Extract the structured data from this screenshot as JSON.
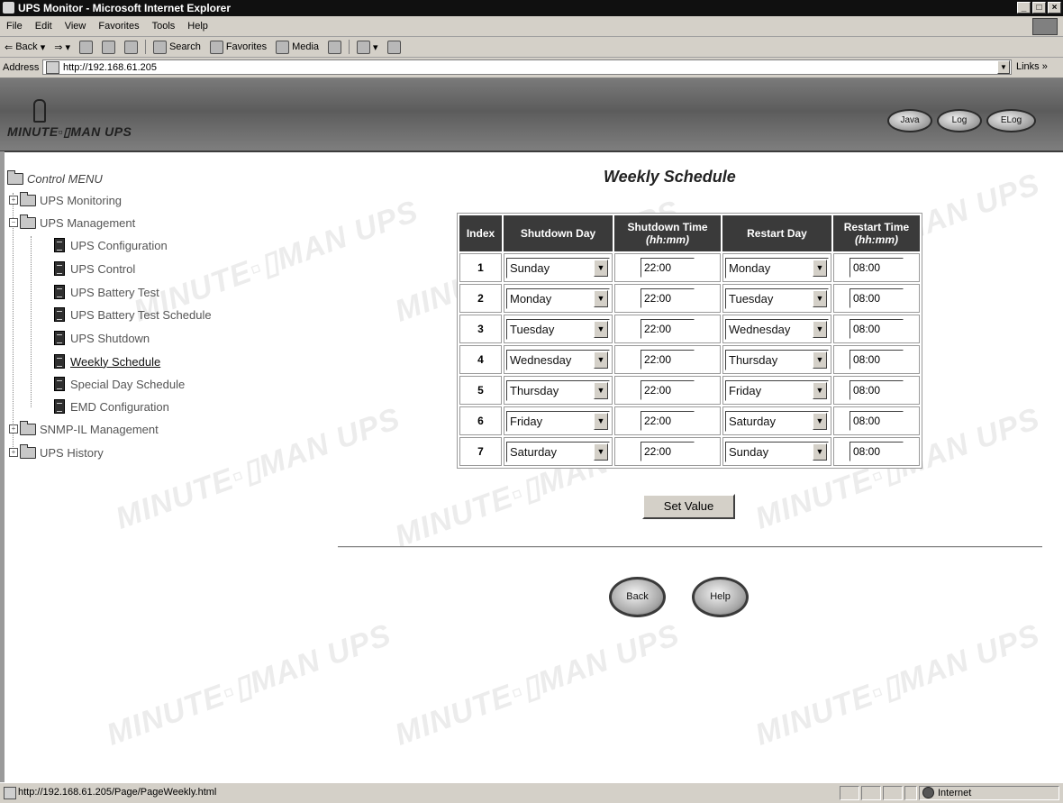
{
  "window": {
    "title": "UPS Monitor - Microsoft Internet Explorer",
    "buttons": [
      "_",
      "□",
      "×"
    ]
  },
  "menubar": [
    "File",
    "Edit",
    "View",
    "Favorites",
    "Tools",
    "Help"
  ],
  "toolbar": {
    "back": "Back",
    "search": "Search",
    "favorites": "Favorites",
    "media": "Media"
  },
  "address": {
    "label": "Address",
    "url": "http://192.168.61.205",
    "links": "Links"
  },
  "header": {
    "logo": "MINUTE▫▯MAN UPS",
    "buttons": [
      "Java",
      "Log",
      "ELog"
    ]
  },
  "leftmenu": {
    "title": "Control MENU",
    "items": [
      {
        "label": "UPS Monitoring"
      },
      {
        "label": "UPS Management"
      },
      {
        "label": "UPS Configuration"
      },
      {
        "label": "UPS Control"
      },
      {
        "label": "UPS Battery Test"
      },
      {
        "label": "UPS Battery Test Schedule"
      },
      {
        "label": "UPS Shutdown"
      },
      {
        "label": "Weekly Schedule"
      },
      {
        "label": "Special Day Schedule"
      },
      {
        "label": "EMD Configuration"
      },
      {
        "label": "SNMP-IL Management"
      },
      {
        "label": "UPS History"
      }
    ]
  },
  "main": {
    "title": "Weekly Schedule",
    "columns": [
      "Index",
      "Shutdown Day",
      "Shutdown Time",
      "(hh:mm)",
      "Restart Day",
      "Restart Time",
      "(hh:mm)"
    ],
    "rows": [
      {
        "index": "1",
        "shutdown_day": "Sunday",
        "shutdown_time": "22:00",
        "restart_day": "Monday",
        "restart_time": "08:00"
      },
      {
        "index": "2",
        "shutdown_day": "Monday",
        "shutdown_time": "22:00",
        "restart_day": "Tuesday",
        "restart_time": "08:00"
      },
      {
        "index": "3",
        "shutdown_day": "Tuesday",
        "shutdown_time": "22:00",
        "restart_day": "Wednesday",
        "restart_time": "08:00"
      },
      {
        "index": "4",
        "shutdown_day": "Wednesday",
        "shutdown_time": "22:00",
        "restart_day": "Thursday",
        "restart_time": "08:00"
      },
      {
        "index": "5",
        "shutdown_day": "Thursday",
        "shutdown_time": "22:00",
        "restart_day": "Friday",
        "restart_time": "08:00"
      },
      {
        "index": "6",
        "shutdown_day": "Friday",
        "shutdown_time": "22:00",
        "restart_day": "Saturday",
        "restart_time": "08:00"
      },
      {
        "index": "7",
        "shutdown_day": "Saturday",
        "shutdown_time": "22:00",
        "restart_day": "Sunday",
        "restart_time": "08:00"
      }
    ],
    "set_button": "Set Value",
    "back_button": "Back",
    "help_button": "Help"
  },
  "watermark": "MINUTE▫▯MAN UPS",
  "statusbar": {
    "url": "http://192.168.61.205/Page/PageWeekly.html",
    "zone": "Internet"
  }
}
